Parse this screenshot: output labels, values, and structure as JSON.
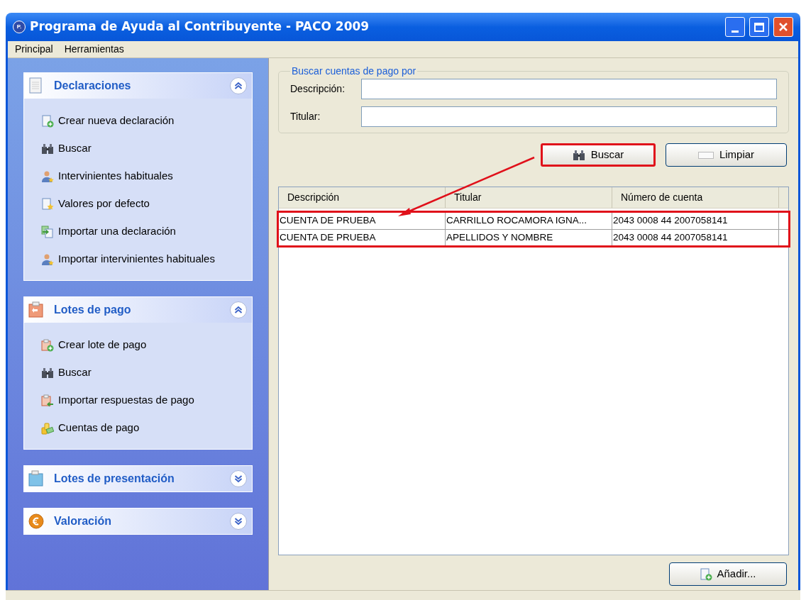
{
  "window": {
    "title": "Programa de Ayuda al Contribuyente - PACO 2009",
    "app_icon_letter": "P."
  },
  "menu": [
    "Principal",
    "Herramientas"
  ],
  "sidebar": {
    "sections": [
      {
        "title": "Declaraciones",
        "kind": "document",
        "expanded": true,
        "items": [
          {
            "label": "Crear nueva declaración",
            "kind": "docadd"
          },
          {
            "label": "Buscar",
            "kind": "binoculars"
          },
          {
            "label": "Intervinientes habituales",
            "kind": "person"
          },
          {
            "label": "Valores por defecto",
            "kind": "docstar"
          },
          {
            "label": "Importar una declaración",
            "kind": "import"
          },
          {
            "label": "Importar intervinientes habituales",
            "kind": "person"
          }
        ]
      },
      {
        "title": "Lotes de pago",
        "kind": "clipboard",
        "expanded": true,
        "items": [
          {
            "label": "Crear lote de pago",
            "kind": "clipadd"
          },
          {
            "label": "Buscar",
            "kind": "binoculars"
          },
          {
            "label": "Importar respuestas de pago",
            "kind": "clipimport"
          },
          {
            "label": "Cuentas de pago",
            "kind": "coins"
          }
        ]
      },
      {
        "title": "Lotes de presentación",
        "kind": "folder",
        "expanded": false
      },
      {
        "title": "Valoración",
        "kind": "euro",
        "expanded": false
      }
    ]
  },
  "search": {
    "legend": "Buscar cuentas de pago por",
    "fields": [
      {
        "label": "Descripción:"
      },
      {
        "label": "Titular:"
      }
    ]
  },
  "buttons": {
    "search": "Buscar",
    "clear": "Limpiar",
    "add": "Añadir..."
  },
  "table": {
    "columns": [
      "Descripción",
      "Titular",
      "Número de cuenta"
    ],
    "rows": [
      [
        "CUENTA DE PRUEBA",
        "CARRILLO ROCAMORA IGNA...",
        "2043 0008 44 2007058141"
      ],
      [
        "CUENTA DE PRUEBA",
        "APELLIDOS Y NOMBRE",
        "2043 0008 44 2007058141"
      ]
    ]
  },
  "annotations": {
    "highlight_search_button": true,
    "highlight_rows": true,
    "arrow": true
  }
}
